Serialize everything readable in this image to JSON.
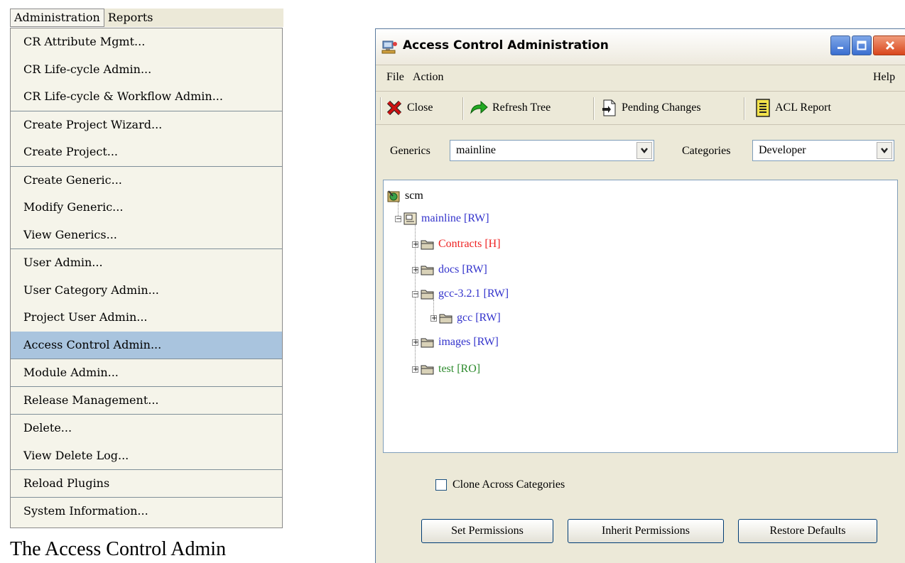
{
  "menubar": {
    "items": [
      {
        "label": "Administration",
        "active": true
      },
      {
        "label": "Reports",
        "active": false
      }
    ]
  },
  "dropdown": {
    "groups": [
      [
        "CR Attribute Mgmt...",
        "CR Life-cycle Admin...",
        "CR Life-cycle & Workflow Admin..."
      ],
      [
        "Create Project Wizard...",
        "Create Project..."
      ],
      [
        "Create Generic...",
        "Modify Generic...",
        "View Generics..."
      ],
      [
        "User Admin...",
        "User Category Admin...",
        "Project User Admin...",
        "Access Control Admin..."
      ],
      [
        "Module Admin..."
      ],
      [
        "Release Management..."
      ],
      [
        "Delete...",
        "View Delete Log..."
      ],
      [
        "Reload Plugins"
      ],
      [
        "System Information..."
      ]
    ],
    "highlighted": "Access Control Admin..."
  },
  "window": {
    "title": "Access Control Administration",
    "menu": {
      "file": "File",
      "action": "Action",
      "help": "Help"
    },
    "toolbar": {
      "close": "Close",
      "refresh": "Refresh Tree",
      "pending": "Pending Changes",
      "acl": "ACL Report"
    },
    "filters": {
      "generics_label": "Generics",
      "generics_value": "mainline",
      "categories_label": "Categories",
      "categories_value": "Developer"
    },
    "tree": {
      "root": "scm",
      "mainline": "mainline [RW]",
      "contracts": "Contracts [H]",
      "docs": "docs [RW]",
      "gcc321": "gcc-3.2.1 [RW]",
      "gcc": "gcc [RW]",
      "images": "images [RW]",
      "test": "test [RO]"
    },
    "clone_label": "Clone Across Categories",
    "buttons": {
      "set": "Set Permissions",
      "inherit": "Inherit Permissions",
      "restore": "Restore Defaults"
    }
  },
  "caption": "The Access Control Admin"
}
